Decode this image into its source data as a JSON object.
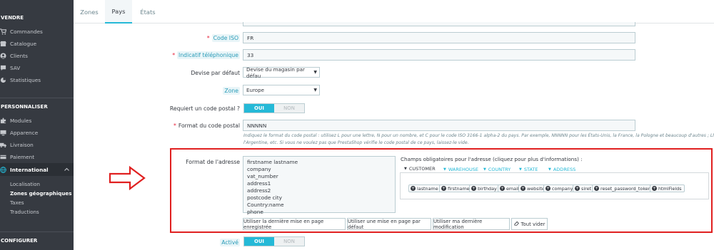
{
  "sidebar": {
    "sections": [
      "VENDRE",
      "PERSONNALISER",
      "CONFIGURER"
    ],
    "vendre_items": [
      {
        "label": "Commandes",
        "icon": "cart-icon"
      },
      {
        "label": "Catalogue",
        "icon": "store-icon"
      },
      {
        "label": "Clients",
        "icon": "user-icon"
      },
      {
        "label": "SAV",
        "icon": "chat-icon"
      },
      {
        "label": "Statistiques",
        "icon": "chart-icon"
      }
    ],
    "personnaliser_items": [
      {
        "label": "Modules",
        "icon": "puzzle-icon"
      },
      {
        "label": "Apparence",
        "icon": "desktop-icon"
      },
      {
        "label": "Livraison",
        "icon": "truck-icon"
      },
      {
        "label": "Paiement",
        "icon": "card-icon"
      },
      {
        "label": "International",
        "icon": "globe-icon"
      }
    ],
    "international_sub": [
      "Localisation",
      "Zones géographiques",
      "Taxes",
      "Traductions"
    ]
  },
  "tabs": [
    "Zones",
    "Pays",
    "États"
  ],
  "form": {
    "code_iso": {
      "label": "Code ISO",
      "value": "FR"
    },
    "indicatif": {
      "label": "Indicatif téléphonique",
      "value": "33"
    },
    "devise": {
      "label": "Devise par défaut",
      "value": "Devise du magasin par défau"
    },
    "zone": {
      "label": "Zone",
      "value": "Europe"
    },
    "code_postal_requis": {
      "label": "Requiert un code postal ?",
      "on": "OUI",
      "off": "NON"
    },
    "format_code_postal": {
      "label": "Format du code postal",
      "value": "NNNNN",
      "help_line1": "Indiquez le format du code postal : utilisez L pour une lettre, N pour un nombre, et C pour le code ISO 3166-1 alpha-2 du pays. Par exemple, NNNNN pour les États-Unis, la France, la Pologne et beaucoup d'autres ; LNNNNLLL pour",
      "help_line2": "l'Argentine, etc. Si vous ne voulez pas que PrestaShop vérifie le code postal de ce pays, laissez-le vide."
    },
    "format_adresse": {
      "label": "Format de l'adresse",
      "lines": [
        "firstname lastname",
        "company",
        "vat_number",
        "address1",
        "address2",
        "postcode city",
        "Country:name",
        "phone"
      ]
    },
    "champs": {
      "title": "Champs obligatoires pour l'adresse (cliquez pour plus d'informations) :",
      "tabs": [
        "CUSTOMER",
        "WAREHOUSE",
        "COUNTRY",
        "STATE",
        "ADDRESS"
      ],
      "chips": [
        "lastname",
        "firstname",
        "birthday",
        "email",
        "website",
        "company",
        "siret",
        "reset_password_token",
        "htmlFields"
      ]
    },
    "buttons": [
      "Utiliser la dernière mise en page enregistrée",
      "Utiliser une mise en page par défaut",
      "Utiliser ma dernière modification",
      "Tout vider"
    ],
    "active": {
      "label": "Activé",
      "on": "OUI",
      "off": "NON"
    }
  },
  "colors": {
    "accent": "#25b9d7",
    "sidebar": "#363a41",
    "highlight_box": "#e02020"
  }
}
